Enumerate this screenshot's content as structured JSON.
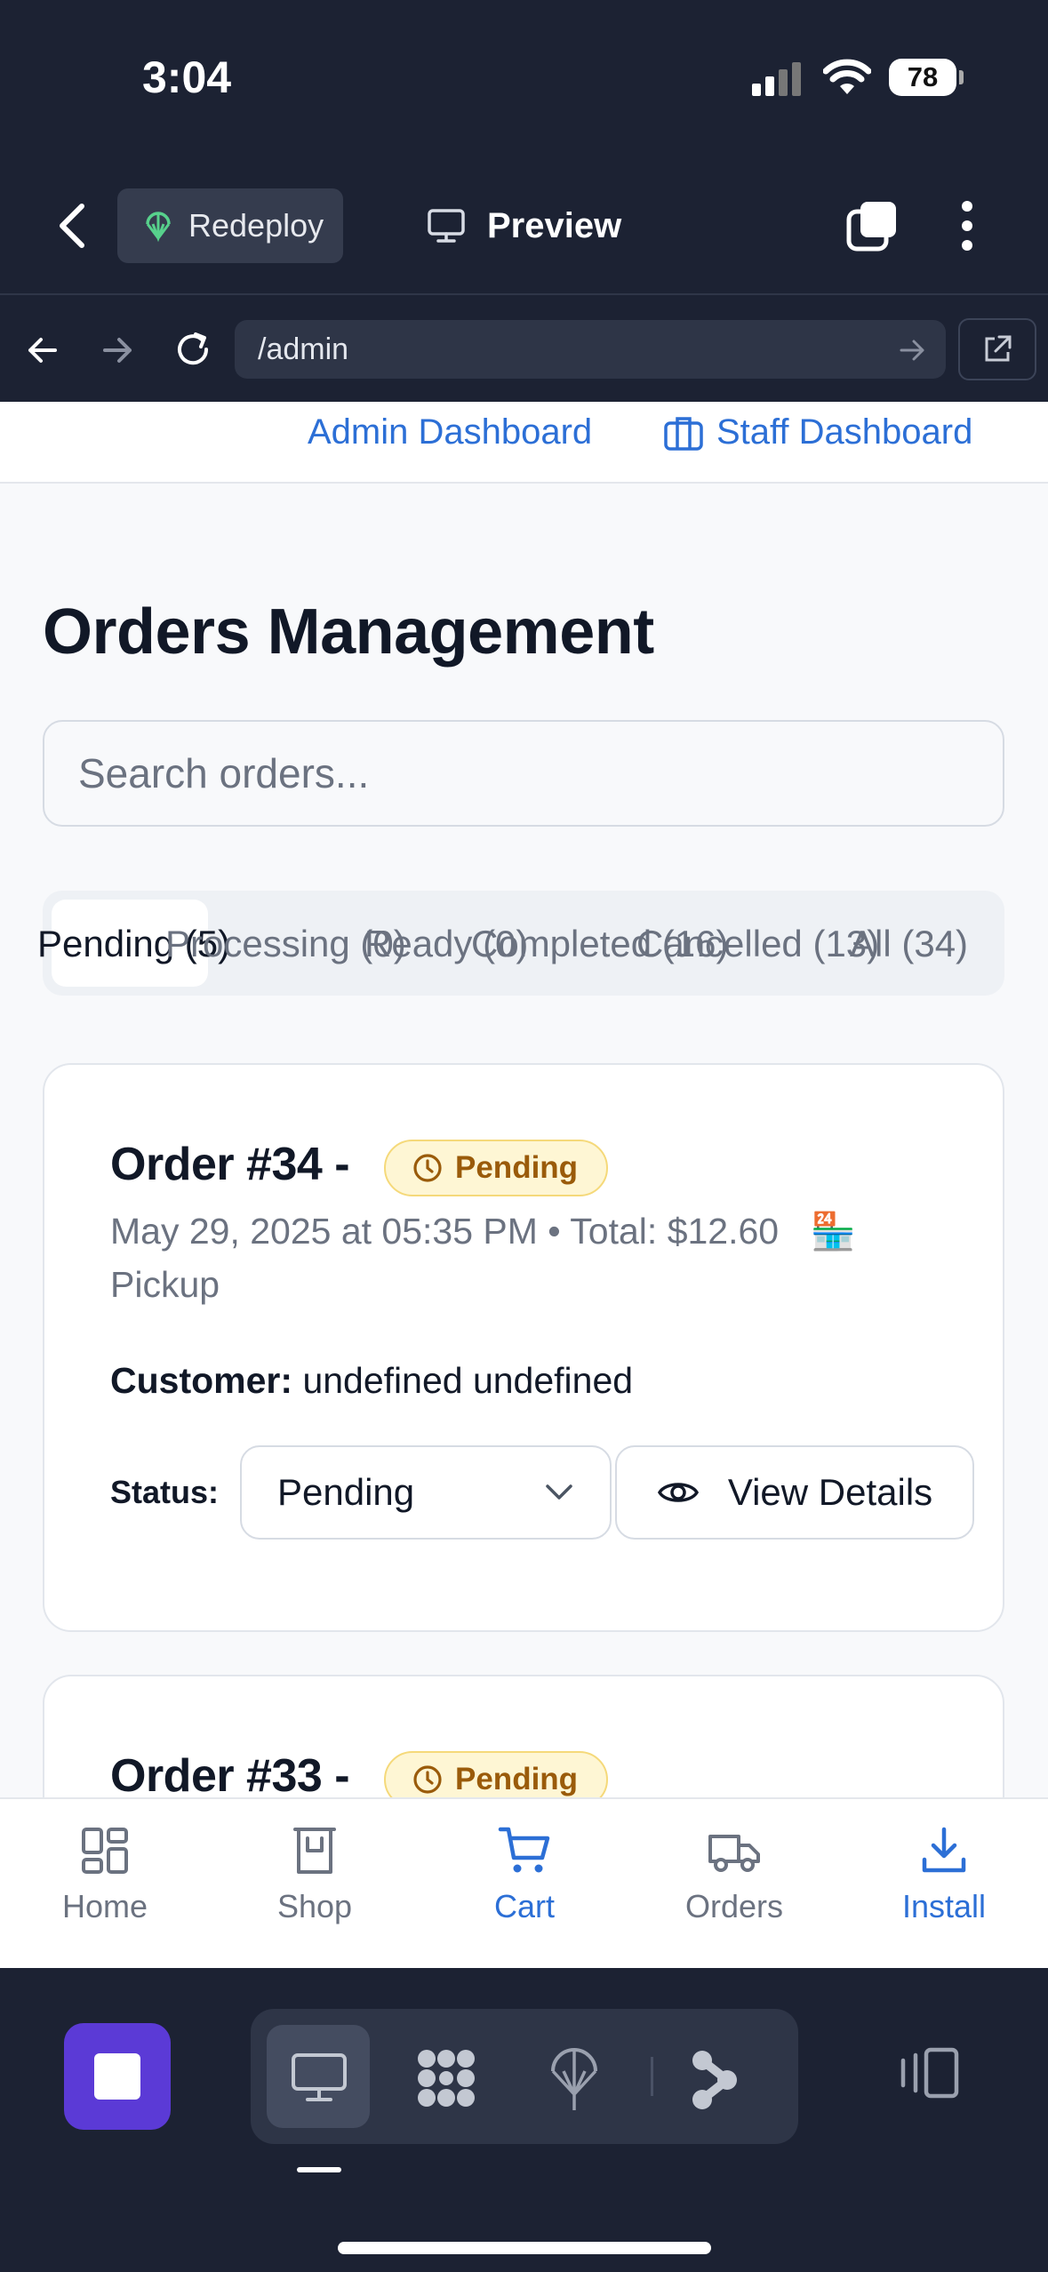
{
  "status_bar": {
    "time": "3:04",
    "battery": "78"
  },
  "app_bar": {
    "redeploy_label": "Redeploy",
    "preview_label": "Preview"
  },
  "browser": {
    "url": "/admin"
  },
  "nav": {
    "admin_dashboard": "Admin Dashboard",
    "staff_dashboard": "Staff Dashboard"
  },
  "page": {
    "title": "Orders Management",
    "search_placeholder": "Search orders...",
    "tabs": [
      {
        "label": "Pending (5)",
        "active": true
      },
      {
        "label": "Processing (0)"
      },
      {
        "label": "Ready (0)"
      },
      {
        "label": "Completed (16)"
      },
      {
        "label": "Cancelled (13)"
      },
      {
        "label": "All (34)"
      }
    ]
  },
  "orders": [
    {
      "title": "Order #34 -",
      "status_badge": "Pending",
      "meta": "May 29, 2025 at 05:35 PM • Total: $12.60",
      "store_emoji": "🏪",
      "fulfillment": "Pickup",
      "customer_label": "Customer:",
      "customer_name": "undefined undefined",
      "status_label": "Status:",
      "status_value": "Pending",
      "view_details": "View Details"
    },
    {
      "title": "Order #33 -",
      "status_badge": "Pending"
    }
  ],
  "bottom_nav": [
    {
      "label": "Home",
      "icon": "home-grid-icon"
    },
    {
      "label": "Shop",
      "icon": "shop-icon"
    },
    {
      "label": "Cart",
      "icon": "cart-icon",
      "active": true
    },
    {
      "label": "Orders",
      "icon": "truck-icon"
    },
    {
      "label": "Install",
      "icon": "download-icon"
    }
  ],
  "colors": {
    "accent": "#2c6fd6",
    "pending_bg": "#fef6d4",
    "pending_text": "#9a5b0a",
    "dark_chrome": "#1c2233",
    "stop_button": "#5b3ad6"
  }
}
